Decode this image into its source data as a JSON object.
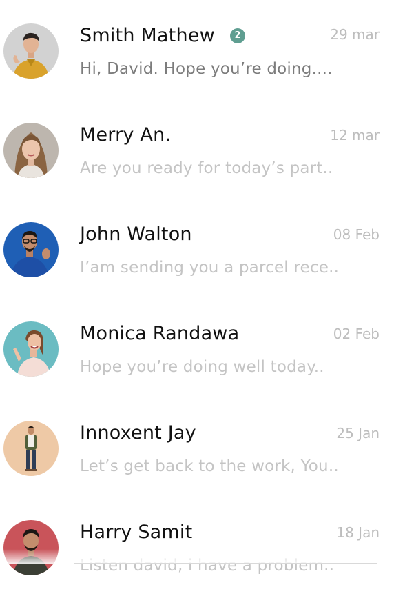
{
  "chats": [
    {
      "name": "Smith Mathew",
      "unread_count": "2",
      "date": "29 mar",
      "preview": "Hi, David. Hope you’re doing....",
      "avatar_icon": "man-yellow-shirt-avatar",
      "avatar_bg": "#cfcfcf",
      "shirt_color": "#d9a22c"
    },
    {
      "name": "Merry An.",
      "date": "12 mar",
      "preview": "Are you ready for today’s part..",
      "avatar_icon": "woman-portrait-avatar",
      "avatar_bg": "#bdb6ae",
      "shirt_color": "#e9e4de"
    },
    {
      "name": "John Walton",
      "date": "08 Feb",
      "preview": "I’am sending you a parcel rece..",
      "avatar_icon": "man-blue-sweater-avatar",
      "avatar_bg": "#1f5fb5",
      "shirt_color": "#1e4fa6"
    },
    {
      "name": "Monica Randawa",
      "date": "02 Feb",
      "preview": "Hope you’re doing well today..",
      "avatar_icon": "woman-teal-background-avatar",
      "avatar_bg": "#6bbcc2",
      "shirt_color": "#f4ddd6"
    },
    {
      "name": "Innoxent Jay",
      "date": "25 Jan",
      "preview": "Let’s get back to the work, You..",
      "avatar_icon": "man-full-body-avatar",
      "avatar_bg": "#eec9a6",
      "shirt_color": "#51603a"
    },
    {
      "name": "Harry Samit",
      "date": "18 Jan",
      "preview": "Listen david, i have a problem..",
      "avatar_icon": "man-red-background-avatar",
      "avatar_bg": "#c9545a",
      "shirt_color": "#3b3f35"
    }
  ],
  "colors": {
    "name_text": "#111111",
    "date_text": "#bdbdbd",
    "preview_read": "#c4c4c4",
    "preview_unread": "#7c7c7c",
    "badge_bg": "#5f9e91"
  }
}
